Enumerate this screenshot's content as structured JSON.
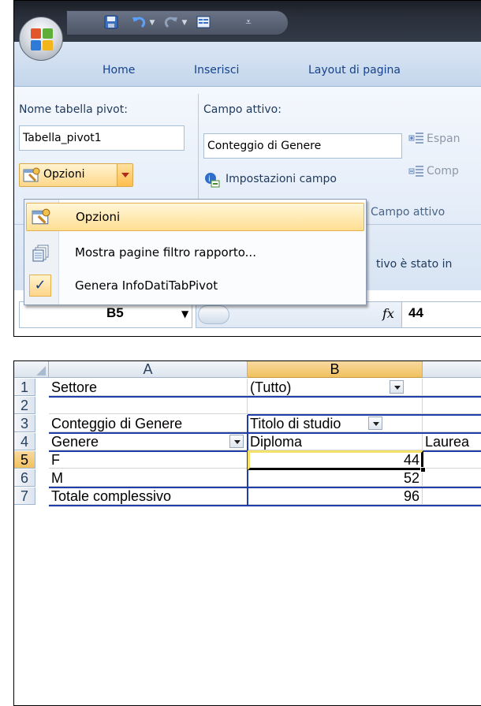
{
  "ribbon_tabs": [
    "Home",
    "Inserisci",
    "Layout di pagina"
  ],
  "pivot_group": {
    "name_label": "Nome tabella pivot:",
    "name_value": "Tabella_pivot1",
    "options_label": "Opzioni"
  },
  "active_field_group": {
    "label": "Campo attivo:",
    "value": "Conteggio di Genere",
    "settings_label": "Impostazioni campo",
    "expand_label": "Espan",
    "collapse_label": "Comp",
    "group_caption": "Campo attivo",
    "truncated_message": "tivo è stato in"
  },
  "menu": {
    "items": [
      {
        "label": "Opzioni",
        "selected": true
      },
      {
        "label": "Mostra pagine filtro rapporto...",
        "selected": false
      },
      {
        "label": "Genera InfoDatiTabPivot",
        "checked": true
      }
    ]
  },
  "formula_bar": {
    "name_box": "B5",
    "fx": "fx",
    "value": "44"
  },
  "sheet": {
    "columns": [
      "A",
      "B"
    ],
    "rows": [
      "1",
      "2",
      "3",
      "4",
      "5",
      "6",
      "7"
    ],
    "cells": {
      "A1": "Settore",
      "B1": "(Tutto)",
      "A3": "Conteggio di Genere",
      "B3": "Titolo di studio",
      "A4": "Genere",
      "B4": "Diploma",
      "C4": "Laurea",
      "A5": "F",
      "B5": "44",
      "A6": "M",
      "B6": "52",
      "A7": "Totale complessivo",
      "B7": "96"
    },
    "selected_cell": "B5"
  },
  "colors": {
    "ribbon_accent": "#15428b",
    "selection_highlight": "#ffd789",
    "pivot_border": "#1f3ea8"
  }
}
